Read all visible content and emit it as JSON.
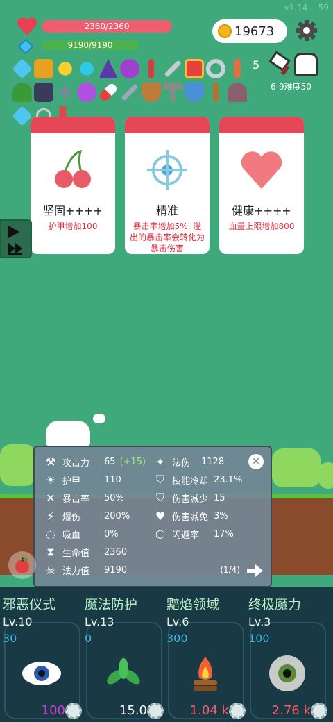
{
  "version": "v1.14",
  "fps": "59",
  "hud": {
    "hp_text": "2360/2360",
    "hp_fraction": 1.0,
    "mp_text": "9190/9190",
    "mp_fraction": 1.0,
    "coins": "19673",
    "stack_count": "5",
    "stage": "6-9难度50"
  },
  "cards": [
    {
      "title": "坚固++++",
      "desc": "护甲增加100",
      "icon": "cherry-icon"
    },
    {
      "title": "精准",
      "desc": "暴击率增加5%, 溢出的暴击率会转化为暴击伤害",
      "icon": "crosshair-icon"
    },
    {
      "title": "健康++++",
      "desc": "血量上限增加800",
      "icon": "heart-icon"
    }
  ],
  "stats": {
    "left": [
      {
        "label": "攻击力",
        "value": "65",
        "bonus": "(+15)",
        "icon": "axe-icon"
      },
      {
        "label": "护甲",
        "value": "110",
        "icon": "sun-icon"
      },
      {
        "label": "暴击率",
        "value": "50%",
        "icon": "cross-swords-icon"
      },
      {
        "label": "爆伤",
        "value": "200%",
        "icon": "lightning-icon"
      },
      {
        "label": "吸血",
        "value": "0%",
        "icon": "ring-icon"
      },
      {
        "label": "生命值",
        "value": "2360",
        "icon": "hourglass-icon"
      },
      {
        "label": "法力值",
        "value": "9190",
        "icon": "skull-icon"
      }
    ],
    "right": [
      {
        "label": "法伤",
        "value": "1128",
        "icon": "wand-icon"
      },
      {
        "label": "技能冷却",
        "value": "23.1%",
        "icon": "shield-icon"
      },
      {
        "label": "伤害减少",
        "value": "15",
        "icon": "shield-half-icon"
      },
      {
        "label": "伤害减免",
        "value": "3%",
        "icon": "heart-icon"
      },
      {
        "label": "闪避率",
        "value": "17%",
        "icon": "hexagon-icon"
      }
    ],
    "page": "(1/4)"
  },
  "skills": [
    {
      "name": "邪恶仪式",
      "level": "Lv.10",
      "cost": "30",
      "value": "100",
      "value_color": "#d93ad9",
      "art": "eye-icon"
    },
    {
      "name": "魔法防护",
      "level": "Lv.13",
      "cost": "0",
      "value": "15.0",
      "value_color": "#ffffff",
      "art": "leaf-icon"
    },
    {
      "name": "黯焰领域",
      "level": "Lv.6",
      "cost": "300",
      "value": "1.04 k",
      "value_color": "#ff5a6a",
      "art": "campfire-icon"
    },
    {
      "name": "终极魔力",
      "level": "Lv.3",
      "cost": "100",
      "value": "2.76 k",
      "value_color": "#ff5a6a",
      "art": "green-eye-icon"
    }
  ],
  "colors": {
    "background": "#3fa97c",
    "card_header": "#e54658",
    "hp": "#ef5e6e",
    "mp": "#4cb24c"
  }
}
